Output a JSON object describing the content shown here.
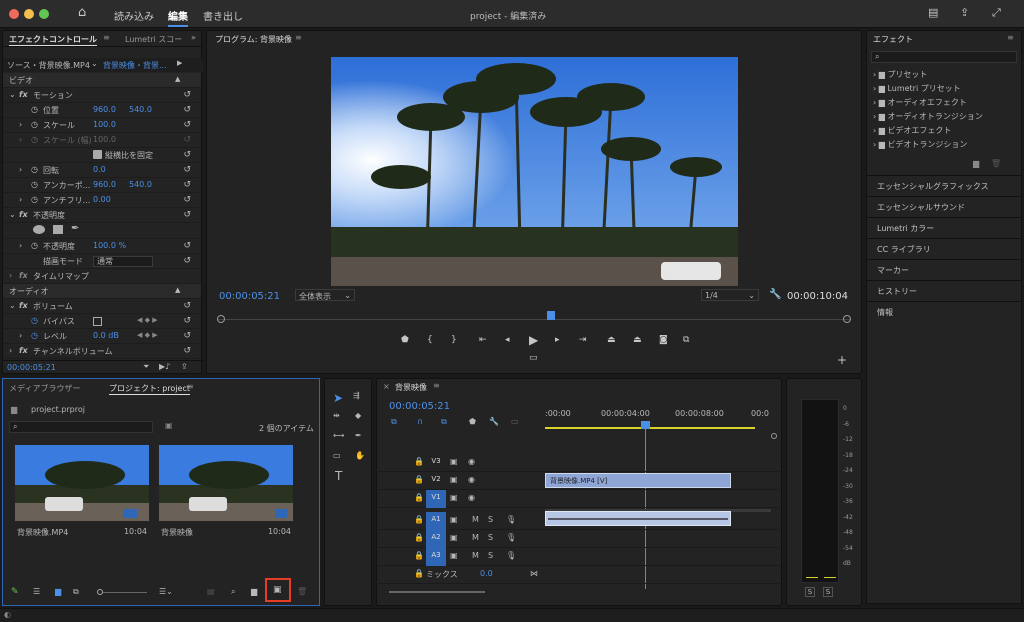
{
  "titlebar": {
    "workspaces": [
      "読み込み",
      "編集",
      "書き出し"
    ],
    "active": "編集",
    "title": "project - 編集済み"
  },
  "effect_controls": {
    "tab": "エフェクトコントロール",
    "tab2": "Lumetri スコー",
    "source": "ソース・背景映像.MP4",
    "clip": "背景映像・背景...",
    "video_header": "ビデオ",
    "motion": "モーション",
    "position": {
      "label": "位置",
      "x": "960.0",
      "y": "540.0"
    },
    "scale": {
      "label": "スケール",
      "value": "100.0"
    },
    "scale_width": {
      "label": "スケール (幅)",
      "value": "100.0"
    },
    "uniform_scale": "縦横比を固定",
    "rotation": {
      "label": "回転",
      "value": "0.0"
    },
    "anchor": {
      "label": "アンカーポ...",
      "x": "960.0",
      "y": "540.0"
    },
    "antiflicker": {
      "label": "アンチフリ...",
      "value": "0.00"
    },
    "opacity_section": "不透明度",
    "opacity": {
      "label": "不透明度",
      "value": "100.0 %"
    },
    "blend": {
      "label": "描画モード",
      "value": "通常"
    },
    "time_remap": "タイムリマップ",
    "audio_header": "オーディオ",
    "volume": "ボリューム",
    "bypass": "バイパス",
    "level": {
      "label": "レベル",
      "value": "0.0 dB"
    },
    "channel_volume": "チャンネルボリューム",
    "timecode": "00:00:05:21"
  },
  "program": {
    "tab": "プログラム: 背景映像",
    "timecode": "00:00:05:21",
    "fit": "全体表示",
    "quality": "1/4",
    "duration": "00:00:10:04"
  },
  "effects": {
    "title": "エフェクト",
    "items": [
      "プリセット",
      "Lumetri プリセット",
      "オーディオエフェクト",
      "オーディオトランジション",
      "ビデオエフェクト",
      "ビデオトランジション"
    ],
    "panels": [
      "エッセンシャルグラフィックス",
      "エッセンシャルサウンド",
      "Lumetri カラー",
      "CC ライブラリ",
      "マーカー",
      "ヒストリー",
      "情報"
    ]
  },
  "project": {
    "tab1": "メディアブラウザー",
    "tab2": "プロジェクト: project",
    "file": "project.prproj",
    "count": "2 個のアイテム",
    "items": [
      {
        "name": "背景映像.MP4",
        "dur": "10:04"
      },
      {
        "name": "背景映像",
        "dur": "10:04"
      }
    ]
  },
  "timeline": {
    "tab": "背景映像",
    "timecode": "00:00:05:21",
    "ruler": [
      ":00:00",
      "00:00:04:00",
      "00:00:08:00",
      "00:0"
    ],
    "video_tracks": [
      "V3",
      "V2",
      "V1"
    ],
    "audio_tracks": [
      "A1",
      "A2",
      "A3"
    ],
    "mix": "ミックス",
    "mix_value": "0.0",
    "clip": "背景映像.MP4 [V]",
    "solo": [
      "M",
      "S"
    ]
  },
  "meter": {
    "scale": [
      "0",
      "-6",
      "-12",
      "-18",
      "-24",
      "-30",
      "-36",
      "-42",
      "-48",
      "-54",
      "dB"
    ],
    "solo": "S"
  },
  "colors": {
    "accent": "#4c8fe6",
    "highlight": "#e53c24"
  }
}
